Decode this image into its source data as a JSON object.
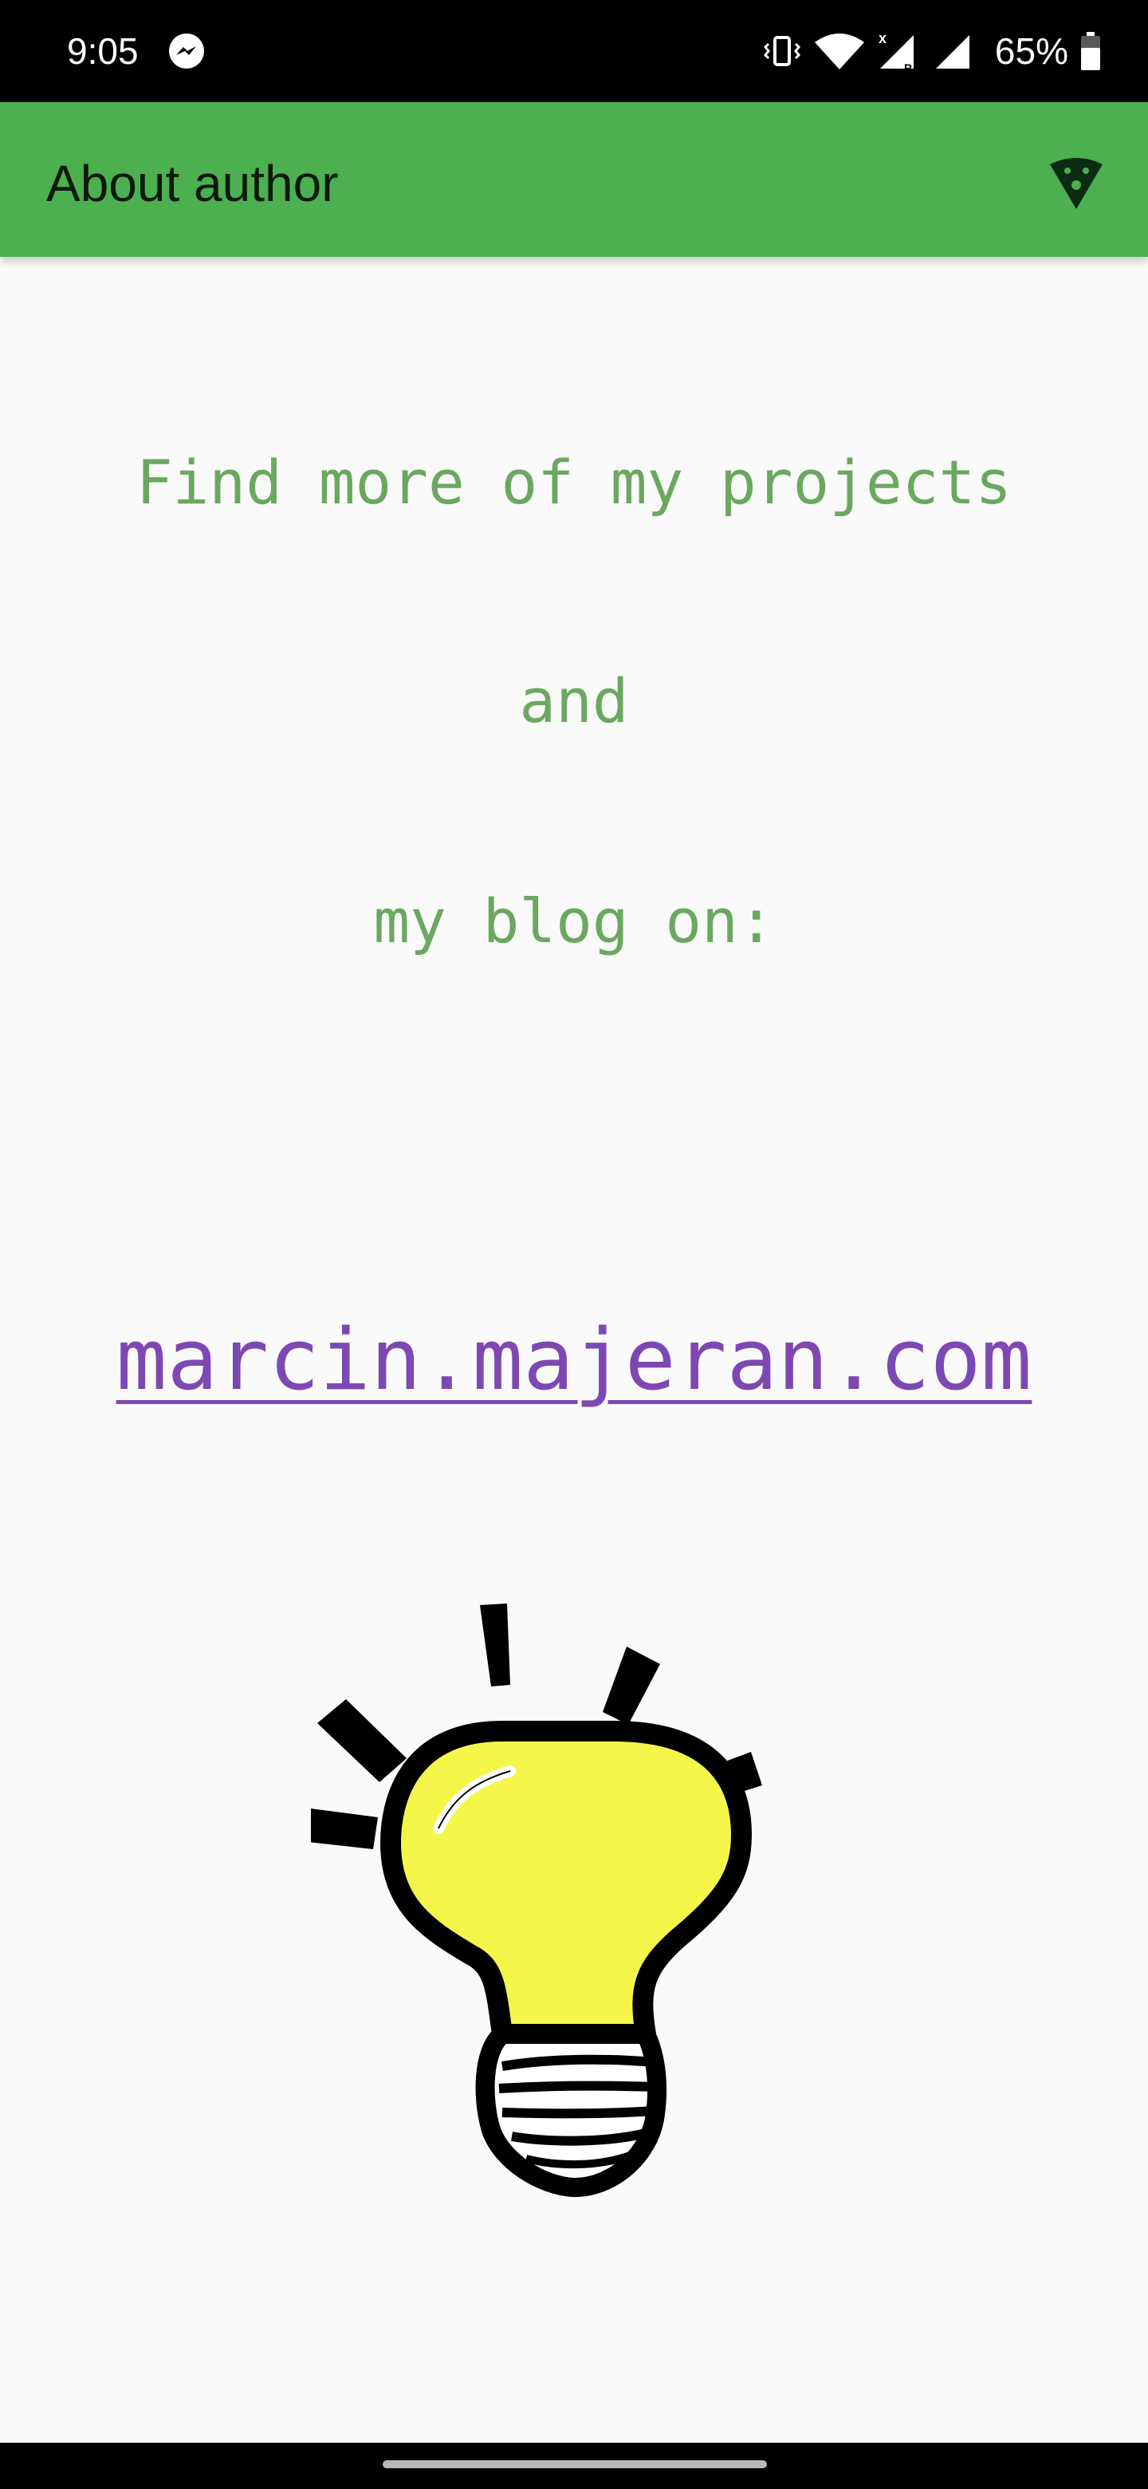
{
  "status_bar": {
    "time": "9:05",
    "battery_percent": "65%",
    "battery_level": 0.65,
    "icons": [
      "messenger-icon",
      "vibrate-icon",
      "wifi-icon",
      "signal-x-icon",
      "signal-icon",
      "battery-icon"
    ]
  },
  "app_bar": {
    "title": "About author",
    "action_icon": "pizza-icon",
    "color": "#4caf50"
  },
  "content": {
    "intro_lines": [
      "Find more of my projects",
      "and",
      "my blog on:"
    ],
    "link": "marcin.majeran.com",
    "text_color": "#6aa85f",
    "link_color": "#7e48b3",
    "illustration": "lightbulb-icon"
  }
}
